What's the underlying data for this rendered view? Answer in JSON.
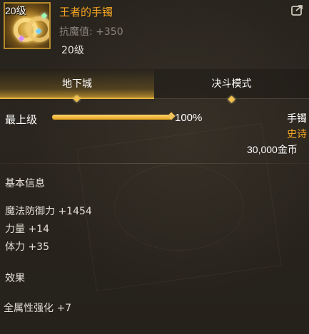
{
  "item": {
    "level_badge": "20级",
    "name": "王者的手镯",
    "stat_line": "抗魔值: +350",
    "level_text": "20级"
  },
  "tabs": [
    {
      "label": "地下城",
      "active": true
    },
    {
      "label": "决斗模式",
      "active": false
    }
  ],
  "grade": {
    "label": "最上级",
    "percent": 100,
    "percent_text": "100%"
  },
  "meta": {
    "type": "手镯",
    "rarity": "史诗",
    "price": "30,000金币"
  },
  "basic_info": {
    "title": "基本信息",
    "stats": [
      "魔法防御力 +1454",
      "力量 +14",
      "体力 +35"
    ]
  },
  "effects": {
    "title": "效果",
    "lines": [
      "全属性强化 +7"
    ]
  },
  "colors": {
    "item_name": "#f5a623",
    "rarity": "#f5a623",
    "progress": "#e5a21f",
    "tab_accent": "#e6b340",
    "background": "#27231d"
  },
  "icons": {
    "item": "bracelet-icon",
    "share": "share-icon"
  }
}
